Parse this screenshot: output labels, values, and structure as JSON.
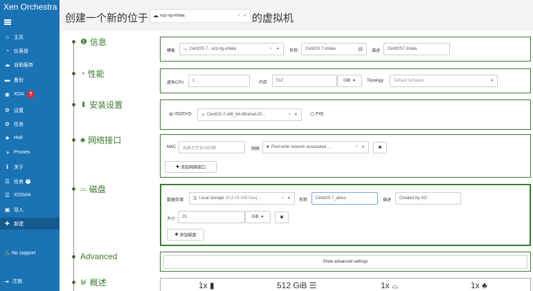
{
  "app": {
    "brand_line1": "Xen Orchestra"
  },
  "sidebar": {
    "items": [
      {
        "label": "主页",
        "icon": "home-icon"
      },
      {
        "label": "仪表盘",
        "icon": "dashboard-icon"
      },
      {
        "label": "自助服务",
        "icon": "cloud-icon"
      },
      {
        "label": "备份",
        "icon": "archive-icon"
      },
      {
        "label": "XOA",
        "icon": "xoa-icon",
        "badge": "?"
      },
      {
        "label": "设置",
        "icon": "gear-icon"
      },
      {
        "label": "任务",
        "icon": "tasks-icon"
      },
      {
        "label": "Hub",
        "icon": "hub-icon"
      },
      {
        "label": "Proxies",
        "icon": "proxies-icon"
      },
      {
        "label": "关于",
        "icon": "info-icon"
      },
      {
        "label": "任务",
        "icon": "tasks-list-icon",
        "badge": "0"
      },
      {
        "label": "XOSAN",
        "icon": "database-icon"
      },
      {
        "label": "导入",
        "icon": "import-icon"
      },
      {
        "label": "新建",
        "icon": "plus-icon"
      }
    ],
    "no_support": "No support",
    "sign_out": "注销"
  },
  "header": {
    "title_prefix": "创建一个新的位于",
    "pool": "xcp-ng-imlala",
    "title_suffix": "的虚拟机"
  },
  "steps": {
    "info": "信息",
    "performance": "性能",
    "install": "安装设置",
    "network": "网络接口",
    "disk": "磁盘",
    "advanced": "Advanced",
    "summary": "概述"
  },
  "info": {
    "template_label": "模板",
    "template_value": "CentOS 7 - xcp-ng-imlala",
    "name_label": "名称",
    "name_value": "CentOS 7 imlala",
    "desc_label": "描述",
    "desc_value": "CentOS7 imlala"
  },
  "performance": {
    "vcpu_label": "虚拟CPU",
    "vcpu_value": "1",
    "memory_label": "内存",
    "memory_value": "512",
    "memory_unit": "GiB",
    "topology_label": "Topology",
    "topology_placeholder": "Default behavior"
  },
  "install": {
    "iso_label": "ISO/DVD",
    "iso_value": "CentOS-7-x86_64-Minimal-20...",
    "pxe_label": "PXE"
  },
  "network": {
    "mac_label": "MAC",
    "mac_placeholder": "如果为空自动创建",
    "network_label": "网络",
    "network_value": "Pool-wide network associated ...",
    "add_label": "添加网络接口"
  },
  "disk": {
    "sr_label": "数据存储",
    "sr_value": "Local storage",
    "sr_free": "(413.03 GiB free)...",
    "name_label": "名称",
    "name_value": "CentOS 7_alevu",
    "desc_label": "描述",
    "desc_value": "Created by XO",
    "size_label": "大小",
    "size_value": "25",
    "size_unit": "GiB",
    "add_label": "添加磁盘"
  },
  "advanced": {
    "button": "Show advanced settings"
  },
  "summary": {
    "cpu": "1x",
    "memory": "512 GiB",
    "disks": "1x",
    "networks": "1x"
  }
}
